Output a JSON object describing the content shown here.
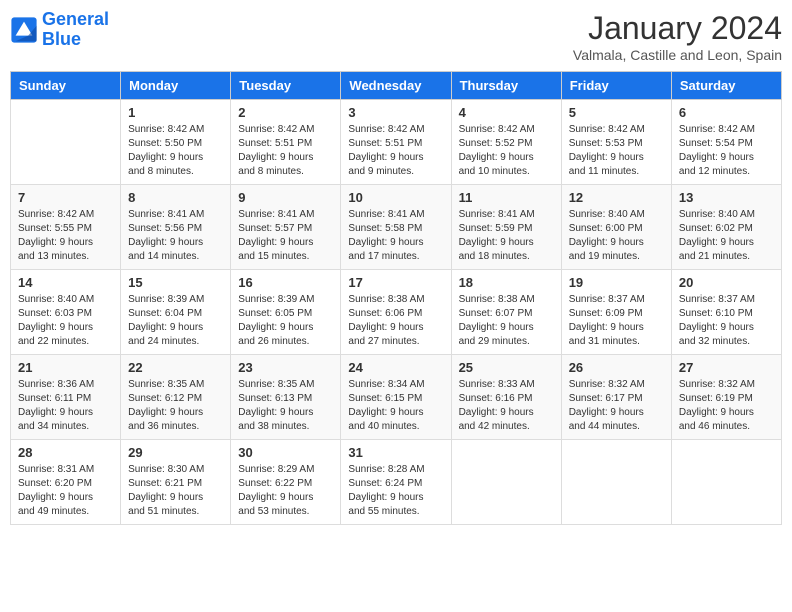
{
  "logo": {
    "line1": "General",
    "line2": "Blue"
  },
  "title": "January 2024",
  "subtitle": "Valmala, Castille and Leon, Spain",
  "days_of_week": [
    "Sunday",
    "Monday",
    "Tuesday",
    "Wednesday",
    "Thursday",
    "Friday",
    "Saturday"
  ],
  "weeks": [
    [
      {
        "day": "",
        "info": ""
      },
      {
        "day": "1",
        "info": "Sunrise: 8:42 AM\nSunset: 5:50 PM\nDaylight: 9 hours\nand 8 minutes."
      },
      {
        "day": "2",
        "info": "Sunrise: 8:42 AM\nSunset: 5:51 PM\nDaylight: 9 hours\nand 8 minutes."
      },
      {
        "day": "3",
        "info": "Sunrise: 8:42 AM\nSunset: 5:51 PM\nDaylight: 9 hours\nand 9 minutes."
      },
      {
        "day": "4",
        "info": "Sunrise: 8:42 AM\nSunset: 5:52 PM\nDaylight: 9 hours\nand 10 minutes."
      },
      {
        "day": "5",
        "info": "Sunrise: 8:42 AM\nSunset: 5:53 PM\nDaylight: 9 hours\nand 11 minutes."
      },
      {
        "day": "6",
        "info": "Sunrise: 8:42 AM\nSunset: 5:54 PM\nDaylight: 9 hours\nand 12 minutes."
      }
    ],
    [
      {
        "day": "7",
        "info": "Sunrise: 8:42 AM\nSunset: 5:55 PM\nDaylight: 9 hours\nand 13 minutes."
      },
      {
        "day": "8",
        "info": "Sunrise: 8:41 AM\nSunset: 5:56 PM\nDaylight: 9 hours\nand 14 minutes."
      },
      {
        "day": "9",
        "info": "Sunrise: 8:41 AM\nSunset: 5:57 PM\nDaylight: 9 hours\nand 15 minutes."
      },
      {
        "day": "10",
        "info": "Sunrise: 8:41 AM\nSunset: 5:58 PM\nDaylight: 9 hours\nand 17 minutes."
      },
      {
        "day": "11",
        "info": "Sunrise: 8:41 AM\nSunset: 5:59 PM\nDaylight: 9 hours\nand 18 minutes."
      },
      {
        "day": "12",
        "info": "Sunrise: 8:40 AM\nSunset: 6:00 PM\nDaylight: 9 hours\nand 19 minutes."
      },
      {
        "day": "13",
        "info": "Sunrise: 8:40 AM\nSunset: 6:02 PM\nDaylight: 9 hours\nand 21 minutes."
      }
    ],
    [
      {
        "day": "14",
        "info": "Sunrise: 8:40 AM\nSunset: 6:03 PM\nDaylight: 9 hours\nand 22 minutes."
      },
      {
        "day": "15",
        "info": "Sunrise: 8:39 AM\nSunset: 6:04 PM\nDaylight: 9 hours\nand 24 minutes."
      },
      {
        "day": "16",
        "info": "Sunrise: 8:39 AM\nSunset: 6:05 PM\nDaylight: 9 hours\nand 26 minutes."
      },
      {
        "day": "17",
        "info": "Sunrise: 8:38 AM\nSunset: 6:06 PM\nDaylight: 9 hours\nand 27 minutes."
      },
      {
        "day": "18",
        "info": "Sunrise: 8:38 AM\nSunset: 6:07 PM\nDaylight: 9 hours\nand 29 minutes."
      },
      {
        "day": "19",
        "info": "Sunrise: 8:37 AM\nSunset: 6:09 PM\nDaylight: 9 hours\nand 31 minutes."
      },
      {
        "day": "20",
        "info": "Sunrise: 8:37 AM\nSunset: 6:10 PM\nDaylight: 9 hours\nand 32 minutes."
      }
    ],
    [
      {
        "day": "21",
        "info": "Sunrise: 8:36 AM\nSunset: 6:11 PM\nDaylight: 9 hours\nand 34 minutes."
      },
      {
        "day": "22",
        "info": "Sunrise: 8:35 AM\nSunset: 6:12 PM\nDaylight: 9 hours\nand 36 minutes."
      },
      {
        "day": "23",
        "info": "Sunrise: 8:35 AM\nSunset: 6:13 PM\nDaylight: 9 hours\nand 38 minutes."
      },
      {
        "day": "24",
        "info": "Sunrise: 8:34 AM\nSunset: 6:15 PM\nDaylight: 9 hours\nand 40 minutes."
      },
      {
        "day": "25",
        "info": "Sunrise: 8:33 AM\nSunset: 6:16 PM\nDaylight: 9 hours\nand 42 minutes."
      },
      {
        "day": "26",
        "info": "Sunrise: 8:32 AM\nSunset: 6:17 PM\nDaylight: 9 hours\nand 44 minutes."
      },
      {
        "day": "27",
        "info": "Sunrise: 8:32 AM\nSunset: 6:19 PM\nDaylight: 9 hours\nand 46 minutes."
      }
    ],
    [
      {
        "day": "28",
        "info": "Sunrise: 8:31 AM\nSunset: 6:20 PM\nDaylight: 9 hours\nand 49 minutes."
      },
      {
        "day": "29",
        "info": "Sunrise: 8:30 AM\nSunset: 6:21 PM\nDaylight: 9 hours\nand 51 minutes."
      },
      {
        "day": "30",
        "info": "Sunrise: 8:29 AM\nSunset: 6:22 PM\nDaylight: 9 hours\nand 53 minutes."
      },
      {
        "day": "31",
        "info": "Sunrise: 8:28 AM\nSunset: 6:24 PM\nDaylight: 9 hours\nand 55 minutes."
      },
      {
        "day": "",
        "info": ""
      },
      {
        "day": "",
        "info": ""
      },
      {
        "day": "",
        "info": ""
      }
    ]
  ]
}
